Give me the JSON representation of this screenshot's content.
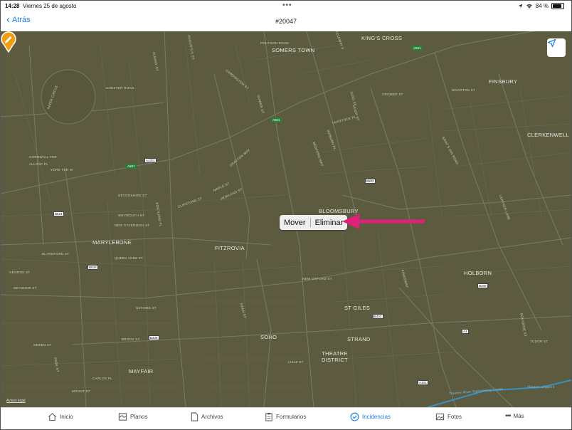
{
  "status": {
    "time": "14:28",
    "date": "Viernes 25 de agosto",
    "battery": "84 %",
    "battery_level": 0.84
  },
  "nav": {
    "back_label": "Atrás",
    "title": "#20047"
  },
  "map": {
    "labels": {
      "kings_cross": "KING'S CROSS",
      "somers_town": "SOMERS TOWN",
      "finsbury": "FINSBURY",
      "clerkenwell": "CLERKENWELL",
      "bloomsbury": "BLOOMSBURY",
      "marylebone": "MARYLEBONE",
      "fitzrovia": "FITZROVIA",
      "holborn": "HOLBORN",
      "st_giles": "ST GILES",
      "strand": "STRAND",
      "soho": "SOHO",
      "theatre_district": "THEATRE\nDISTRICT",
      "mayfair": "MAYFAIR"
    },
    "streets": {
      "chester_road": "CHESTER ROAD",
      "inner_circle": "INNER CIRCLE",
      "cornwall_ter": "CORNWALL TER",
      "allsop_pl": "ALLSOP PL",
      "york_ter_w": "YORK TER W",
      "devonshire_st": "DEVONSHIRE ST",
      "weymouth_st": "WEYMOUTH ST",
      "new_cavendish_st": "NEW CAVENDISH ST",
      "blandford_st": "BLANDFORD ST",
      "george_st": "GEORGE ST",
      "seymour_st": "SEYMOUR ST",
      "oxford_st": "OXFORD ST",
      "queen_anne_st": "QUEEN ANNE ST",
      "green_st": "GREEN ST",
      "brook_st": "BROOK ST",
      "mount_st": "MOUNT ST",
      "new_oxford_st": "NEW OXFORD ST",
      "portland_pl": "PORTLAND PL",
      "gower_st": "GOWER ST",
      "woburn_pl": "WOBURN PL",
      "tavistock_pl": "TAVISTOCK PL",
      "euston_rd": "EUSTON RD",
      "grays_inn_road": "GRAY'S INN ROAD",
      "kingsway": "KINGSWAY",
      "farringdon": "FARRINGDON RD",
      "cromer_st": "CROMER ST",
      "wharton_st": "WHARTON ST",
      "polygon_road": "POLYGON ROAD",
      "cardington_st": "CARDINGTON ST",
      "grafton_way": "GRAFTON WAY",
      "maple_st": "MAPLE ST",
      "howland_st": "HOWLAND ST",
      "clipstone_st": "CLIPSTONE ST",
      "bedford_way": "BEDFORD WAY",
      "lisle_st": "LISLE ST",
      "dean_st": "DEAN ST",
      "leather_lane": "LEATHER LANE",
      "tudor_st": "TUDOR ST",
      "bouverie_st": "BOUVERIE ST",
      "park_st": "PARK ST",
      "south_st": "SOUTH ST",
      "carlos_pl": "CARLOS PL",
      "albany_st": "ALBANY ST",
      "augustus_st": "AUGUSTUS ST",
      "eversholt_st": "EVERSHOLT ST",
      "judd_st": "JUDD ST",
      "leigh_st": "LEIGH ST",
      "marchmont_st": "MARCHMONT ST",
      "harrington_sq": "HARRINGTON SQ",
      "great_portland_st": "GREAT PORTLAND ST",
      "wells_st": "WELLS ST",
      "theobalds_rd": "THEOBALDS RD",
      "hatton_garden": "HATTON GDN",
      "red_lion_st": "RED LION ST",
      "aldwych": "ALDWYCH",
      "cyclway": "CYCLEWAY 6",
      "gerrard_st": "GERRARD ST",
      "thames_clippers": "Thames Clippers",
      "thames_cruise": "Thames River Sightseeing Cruise"
    },
    "shields": {
      "a501_top": "A501",
      "a501_mid": "A501",
      "a501_left": "A501",
      "a4201": "A4201",
      "b524": "B524",
      "b526": "B526",
      "b502": "B502",
      "b400": "B400",
      "b402": "B402",
      "b406": "B406",
      "a4": "A4",
      "a301": "A301"
    },
    "attribution": "Avisos legal"
  },
  "popup": {
    "move_label": "Mover",
    "delete_label": "Eliminar"
  },
  "colors": {
    "accent": "#1a7fe0",
    "map_bg": "#5c5b3f",
    "arrow": "#e0217a",
    "pin": "#f39c12"
  },
  "tabs": [
    {
      "label": "Inicio",
      "icon": "home-icon"
    },
    {
      "label": "Planos",
      "icon": "plans-icon"
    },
    {
      "label": "Archivos",
      "icon": "files-icon"
    },
    {
      "label": "Formularios",
      "icon": "forms-icon"
    },
    {
      "label": "Incidencias",
      "icon": "incidents-icon",
      "active": true
    },
    {
      "label": "Fotos",
      "icon": "photos-icon"
    },
    {
      "label": "Más",
      "icon": "more-icon"
    }
  ]
}
